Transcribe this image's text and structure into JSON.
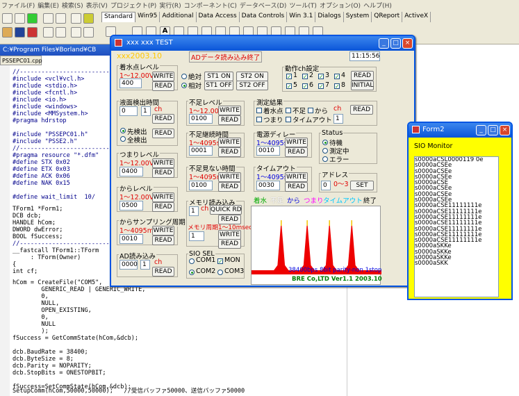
{
  "ide": {
    "menu": [
      "ファイル(F)",
      "編集(E)",
      "検索(S)",
      "表示(V)",
      "プロジェクト(P)",
      "実行(R)",
      "コンポーネント(C)",
      "データベース(D)",
      "ツール(T)",
      "オプション(O)",
      "ヘルプ(H)"
    ],
    "palette_tabs": [
      "Standard",
      "Win95",
      "Additional",
      "Data Access",
      "Data Controls",
      "Win 3.1",
      "Dialogs",
      "System",
      "QReport",
      "ActiveX"
    ],
    "title": "C:¥Program Files¥Borland¥CB",
    "file_tab": "PSSEPC01.cpp",
    "code_lines": [
      "//--------------------------------------------------------",
      "#include <vcl¥vcl.h>",
      "#include <stdio.h>",
      "#include <fcntl.h>",
      "#include <io.h>",
      "#include <windows>",
      "#include <MMSystem.h>",
      "#pragma hdrstop",
      "",
      "#include \"PSSEPC01.h\"",
      "#include \"PSSE2.h\"",
      "//--------------------------------------------------------",
      "#pragma resource \"*.dfm\"",
      "#define STX 0x02",
      "#define ETX 0x03",
      "#define ACK 0x06",
      "#define NAK 0x15",
      "",
      "#define wait_limit  10/"
    ],
    "code_lines2": [
      "TForm1 *Form1;",
      "DCB dcb;",
      "HANDLE hCom;",
      "DWORD dwError;",
      "BOOL fSuccess;",
      "//------------------------------",
      "__fastcall TForm1::TForm",
      "     : TForm(Owner)",
      "{",
      "int cf;"
    ],
    "code_lines3": [
      "hCom = CreateFile(\"COM5\",",
      "        GENERIC_READ | GENERIC_WRITE,",
      "        0,",
      "        NULL,",
      "        OPEN_EXISTING,",
      "        0,",
      "        NULL",
      "        );",
      "fSuccess = GetCommState(hCom,&dcb);",
      "",
      "dcb.BaudRate = 38400;",
      "dcb.ByteSize = 8;",
      "dcb.Parity = NOPARITY;",
      "dcb.StopBits = ONESTOPBIT;",
      "",
      "fSuccess=SetCommState(hCom,&dcb);"
    ],
    "last_code": "SetupComm(hCom,50000,50000);",
    "last_comment": "//受信バッファ50000、送信バッファ50000"
  },
  "form1": {
    "title": "xxx xxx TEST",
    "top_left": "xxx2003.10",
    "ad_status": "ADデータ読み込み終了",
    "clock": "11:15:56",
    "water_level": {
      "label": "着水点レベル",
      "range": "1～12.00V",
      "value": "400",
      "write": "WRITE",
      "read": "READ"
    },
    "mode": {
      "absolute": "絶対",
      "relative": "相対",
      "st1_on": "ST1 ON",
      "st2_on": "ST2 ON",
      "st1_off": "ST1 OFF",
      "st2_off": "ST2 OFF"
    },
    "channels": {
      "label": "動作ch設定",
      "items": [
        "1",
        "2",
        "3",
        "4",
        "5",
        "6",
        "7",
        "8"
      ],
      "read": "READ",
      "initial": "INITIAL"
    },
    "detect_time": {
      "label": "液面検出時間",
      "value": "0",
      "ch_value": "1",
      "ch": "ch",
      "read": "READ",
      "first": "先検出",
      "all": "全検出"
    },
    "short_level": {
      "label": "不足レベル",
      "range": "1～12.00V",
      "value": "0100",
      "write": "WRITE",
      "read": "READ"
    },
    "result": {
      "label": "測定結果",
      "water": "着水点",
      "short": "不足",
      "kara": "から",
      "ch": "ch",
      "tsumari": "つまり",
      "timeout": "タイムアウト",
      "ch_value": "1",
      "read": "READ"
    },
    "tsumari_level": {
      "label": "つまりレベル",
      "range": "1～12.00V",
      "value": "0400",
      "write": "WRITE",
      "read": "READ"
    },
    "short_cont": {
      "label": "不足継続時間",
      "range": "1～4095s",
      "value": "0001",
      "write": "WRITE",
      "read": "READ"
    },
    "power_delay": {
      "label": "電源ディレー",
      "range": "1～4095s",
      "value": "0010",
      "write": "WRITE",
      "read": "READ"
    },
    "status": {
      "label": "Status",
      "standby": "待機",
      "measuring": "測定中",
      "error": "エラー"
    },
    "kara_level": {
      "label": "からレベル",
      "range": "1～12.00V",
      "value": "0500",
      "write": "WRITE",
      "read": "READ"
    },
    "short_invisible": {
      "label": "不足見ない時間",
      "range": "1～4095m",
      "value": "0100",
      "write": "WRITE",
      "read": "READ"
    },
    "timeout_box": {
      "label": "タイムアウト",
      "range": "1～4095s",
      "value": "0030",
      "write": "WRITE",
      "read": "READ"
    },
    "address": {
      "label": "アドレス",
      "value": "0",
      "range": "0～3",
      "set": "SET"
    },
    "kara_sampling": {
      "label": "からサンプリング周期",
      "range": "1～4095m",
      "value": "0010",
      "write": "WRITE",
      "read": "READ"
    },
    "memory_read": {
      "label": "メモリ読み込み",
      "value": "1",
      "ch": "ch",
      "quick": "QUICK RD",
      "read": "READ",
      "period": "メモリ周期1～10msec",
      "period_value": "1",
      "write": "WRITE",
      "read2": "READ"
    },
    "ad_read": {
      "label": "AD読み込み",
      "value": "0000",
      "ch_value": "1",
      "ch": "ch",
      "read": "READ"
    },
    "sio": {
      "label": "SIO SEL",
      "com1": "COM1",
      "mon": "MON",
      "com2": "COM2",
      "com3": "COM3"
    },
    "legend": {
      "water": "着水",
      "short": "不足",
      "kara": "から",
      "tsumari": "つまり",
      "timeout": "タイムアウト",
      "end": "終了"
    },
    "graph_caption": "38400bps 8bit parity-non 1stop",
    "footer": "BRE Co,LTD Ver1.1 2003.10",
    "colors": {
      "red": "#e00000",
      "blue": "#0000e0",
      "green": "#00aa00",
      "graph_bg": "#ffffff",
      "graph_line": "#ee0000"
    }
  },
  "form2": {
    "title": "Form2",
    "label": "SIO  Monitor",
    "lines": [
      "s0000aCSL0000119 0e",
      "s0000aCSEe",
      "s0000aCSEe",
      "s0000aCSEe",
      "s0000aCSE",
      "s0000aCSEe",
      "s0000aCSEe",
      "s0000aCSEe",
      "s0000aCSE11111111e",
      "s0000aCSE11111111e",
      "s0000aCSE11111111e",
      "s0000aCSE11111111e",
      "s0000aCSE11111111e",
      "s0000aCSE11111111e",
      "s0000aCSE11111111e",
      "s0000aSKKe",
      "s0000aSKKe",
      "s0000aSKKe",
      "s0000aSKK"
    ]
  },
  "chart_data": {
    "type": "area",
    "title": "",
    "xlabel": "",
    "ylabel": "",
    "caption": "38400bps 8bit parity-non 1stop",
    "series": [
      {
        "values": [
          0,
          0,
          0,
          0,
          0,
          0,
          0,
          1,
          10,
          1,
          0,
          0,
          0,
          0,
          1,
          10,
          1,
          0,
          0,
          0,
          1,
          10,
          1,
          0,
          0,
          0,
          1,
          10,
          1,
          0,
          0,
          0,
          0,
          0,
          0,
          0
        ]
      }
    ]
  }
}
